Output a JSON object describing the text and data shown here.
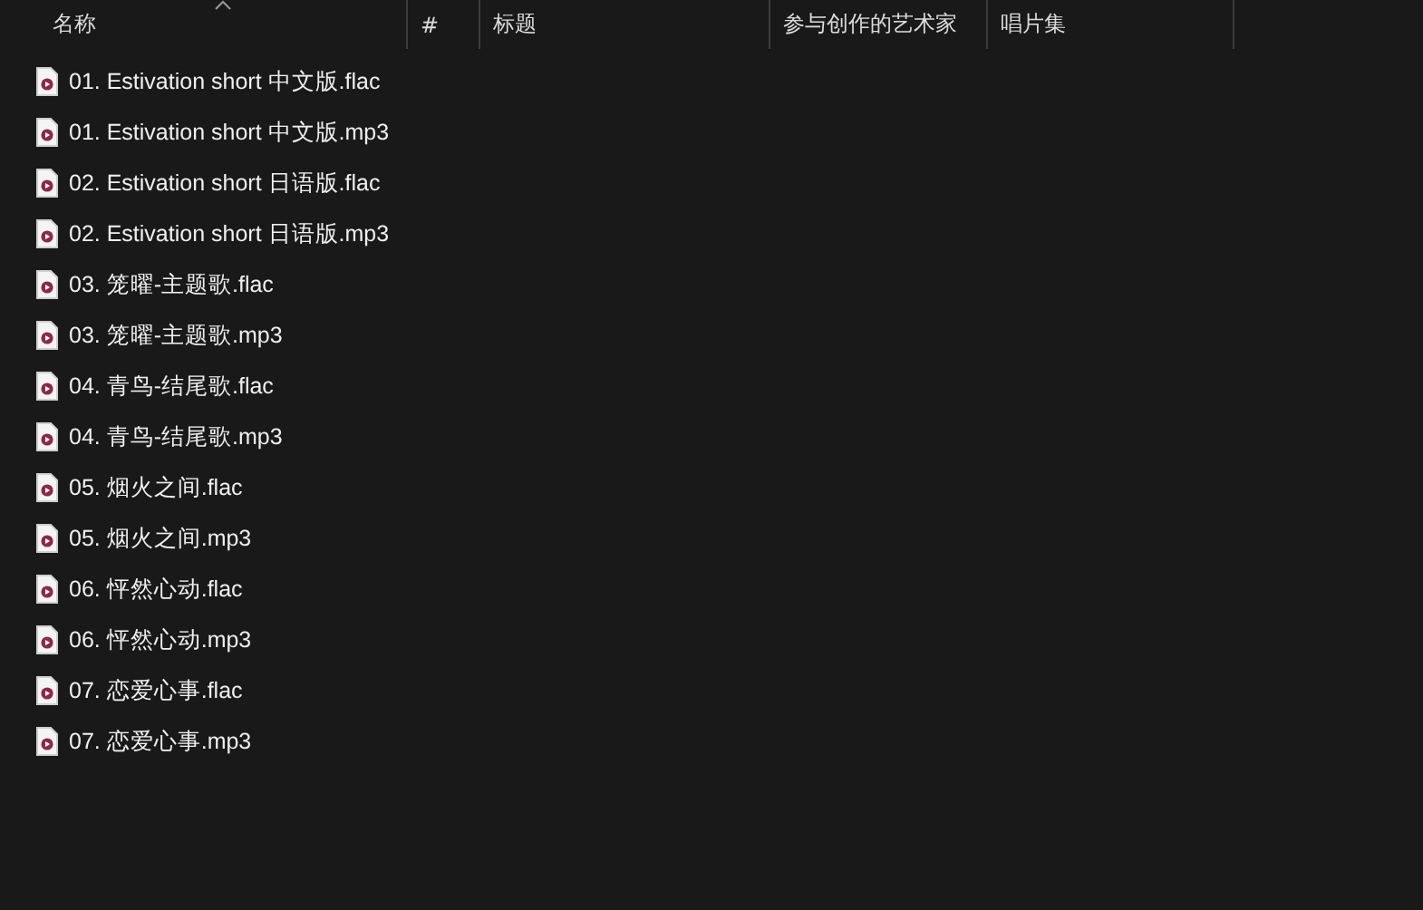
{
  "columns": [
    {
      "label": "名称",
      "sorted": true
    },
    {
      "label": "#",
      "sorted": false
    },
    {
      "label": "标题",
      "sorted": false
    },
    {
      "label": "参与创作的艺术家",
      "sorted": false
    },
    {
      "label": "唱片集",
      "sorted": false
    }
  ],
  "files": [
    {
      "name": "01. Estivation short 中文版.flac"
    },
    {
      "name": "01. Estivation short 中文版.mp3"
    },
    {
      "name": "02. Estivation short 日语版.flac"
    },
    {
      "name": "02. Estivation short 日语版.mp3"
    },
    {
      "name": "03. 笼曜-主题歌.flac"
    },
    {
      "name": "03. 笼曜-主题歌.mp3"
    },
    {
      "name": "04. 青鸟-结尾歌.flac"
    },
    {
      "name": "04. 青鸟-结尾歌.mp3"
    },
    {
      "name": "05. 烟火之间.flac"
    },
    {
      "name": "05. 烟火之间.mp3"
    },
    {
      "name": "06. 怦然心动.flac"
    },
    {
      "name": "06. 怦然心动.mp3"
    },
    {
      "name": "07. 恋爱心事.flac"
    },
    {
      "name": "07. 恋爱心事.mp3"
    }
  ]
}
